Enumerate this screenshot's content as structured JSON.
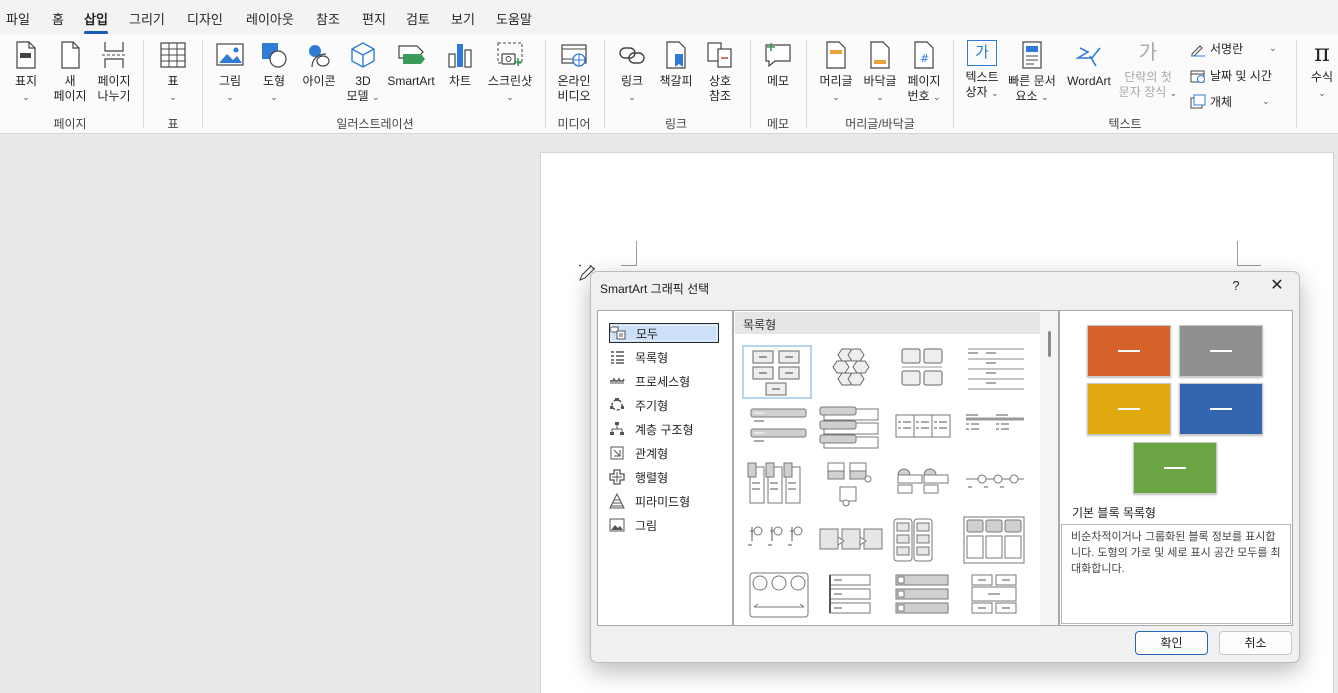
{
  "menu": {
    "tabs": [
      "파일",
      "홈",
      "삽입",
      "그리기",
      "디자인",
      "레이아웃",
      "참조",
      "편지",
      "검토",
      "보기",
      "도움말"
    ],
    "active": "삽입"
  },
  "ribbon": {
    "pages": {
      "cover_l1": "표지",
      "blank_l1": "새",
      "blank_l2": "페이지",
      "break_l1": "페이지",
      "break_l2": "나누기",
      "label": "페이지"
    },
    "table": {
      "btn": "표",
      "label": "표"
    },
    "illustrations": {
      "picture": "그림",
      "shape": "도형",
      "icons": "아이콘",
      "model_l1": "3D",
      "model_l2": "모델",
      "smartart": "SmartArt",
      "chart": "차트",
      "screenshot": "스크린샷",
      "label": "일러스트레이션"
    },
    "media": {
      "video_l1": "온라인",
      "video_l2": "비디오",
      "label": "미디어"
    },
    "links": {
      "link": "링크",
      "bookmark": "책갈피",
      "xref_l1": "상호",
      "xref_l2": "참조",
      "label": "링크"
    },
    "comments": {
      "comment": "메모",
      "label": "메모"
    },
    "header_footer": {
      "header": "머리글",
      "footer": "바닥글",
      "pagenum_l1": "페이지",
      "pagenum_l2": "번호",
      "label": "머리글/바닥글"
    },
    "text": {
      "textbox_l1": "텍스트",
      "textbox_l2": "상자",
      "quickparts_l1": "빠른 문서",
      "quickparts_l2": "요소",
      "wordart": "WordArt",
      "dropcap_l1": "단락의 첫",
      "dropcap_l2": "문자 장식",
      "dropcap_glyph": "가",
      "textbox_glyph": "가",
      "signature": "서명란",
      "datetime": "날짜 및 시간",
      "object": "개체",
      "label": "텍스트"
    },
    "symbols": {
      "equation": "수식",
      "glyph": "π"
    }
  },
  "dialog": {
    "title": "SmartArt 그래픽 선택",
    "help": "?",
    "close": "✕",
    "categories": [
      "모두",
      "목록형",
      "프로세스형",
      "주기형",
      "계층 구조형",
      "관계형",
      "행렬형",
      "피라미드형",
      "그림"
    ],
    "selected_category": "모두",
    "gallery_header": "목록형",
    "preview": {
      "title": "기본 블록 목록형",
      "description": "비순차적이거나 그룹화된 블록 정보를 표시합니다. 도형의 가로 및 세로 표시 공간 모두를 최대화합니다.",
      "colors": [
        "#d4622a",
        "#8f8f8f",
        "#e0a90f",
        "#3465b0",
        "#6aa443"
      ]
    },
    "ok": "확인",
    "cancel": "취소"
  }
}
